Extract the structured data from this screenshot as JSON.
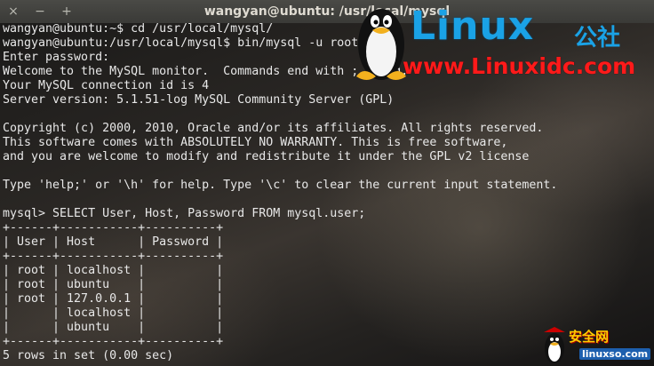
{
  "window": {
    "title": "wangyan@ubuntu: /usr/local/mysql",
    "controls": {
      "close": "×",
      "minimize": "−",
      "maximize": "+"
    }
  },
  "terminal": {
    "lines": [
      "wangyan@ubuntu:~$ cd /usr/local/mysql/",
      "wangyan@ubuntu:/usr/local/mysql$ bin/mysql -u root -p",
      "Enter password:",
      "Welcome to the MySQL monitor.  Commands end with ; or \\g.",
      "Your MySQL connection id is 4",
      "Server version: 5.1.51-log MySQL Community Server (GPL)",
      "",
      "Copyright (c) 2000, 2010, Oracle and/or its affiliates. All rights reserved.",
      "This software comes with ABSOLUTELY NO WARRANTY. This is free software,",
      "and you are welcome to modify and redistribute it under the GPL v2 license",
      "",
      "Type 'help;' or '\\h' for help. Type '\\c' to clear the current input statement.",
      "",
      "mysql> SELECT User, Host, Password FROM mysql.user;",
      "+------+-----------+----------+",
      "| User | Host      | Password |",
      "+------+-----------+----------+",
      "| root | localhost |          |",
      "| root | ubuntu    |          |",
      "| root | 127.0.0.1 |          |",
      "|      | localhost |          |",
      "|      | ubuntu    |          |",
      "+------+-----------+----------+",
      "5 rows in set (0.00 sec)"
    ]
  },
  "watermark": {
    "brand": "Linux",
    "brand_cn": "公社",
    "url": "www.Linuxidc.com"
  },
  "badge": {
    "cn": "安全网",
    "url": "linuxso.com"
  },
  "colors": {
    "terminal_text": "#e8e8e8",
    "brand_blue": "#1aa2e6",
    "url_red": "#ff1a1a"
  },
  "icons": {
    "close": "close-icon",
    "minimize": "minimize-icon",
    "maximize": "maximize-icon",
    "logo": "tux-penguin-icon"
  }
}
